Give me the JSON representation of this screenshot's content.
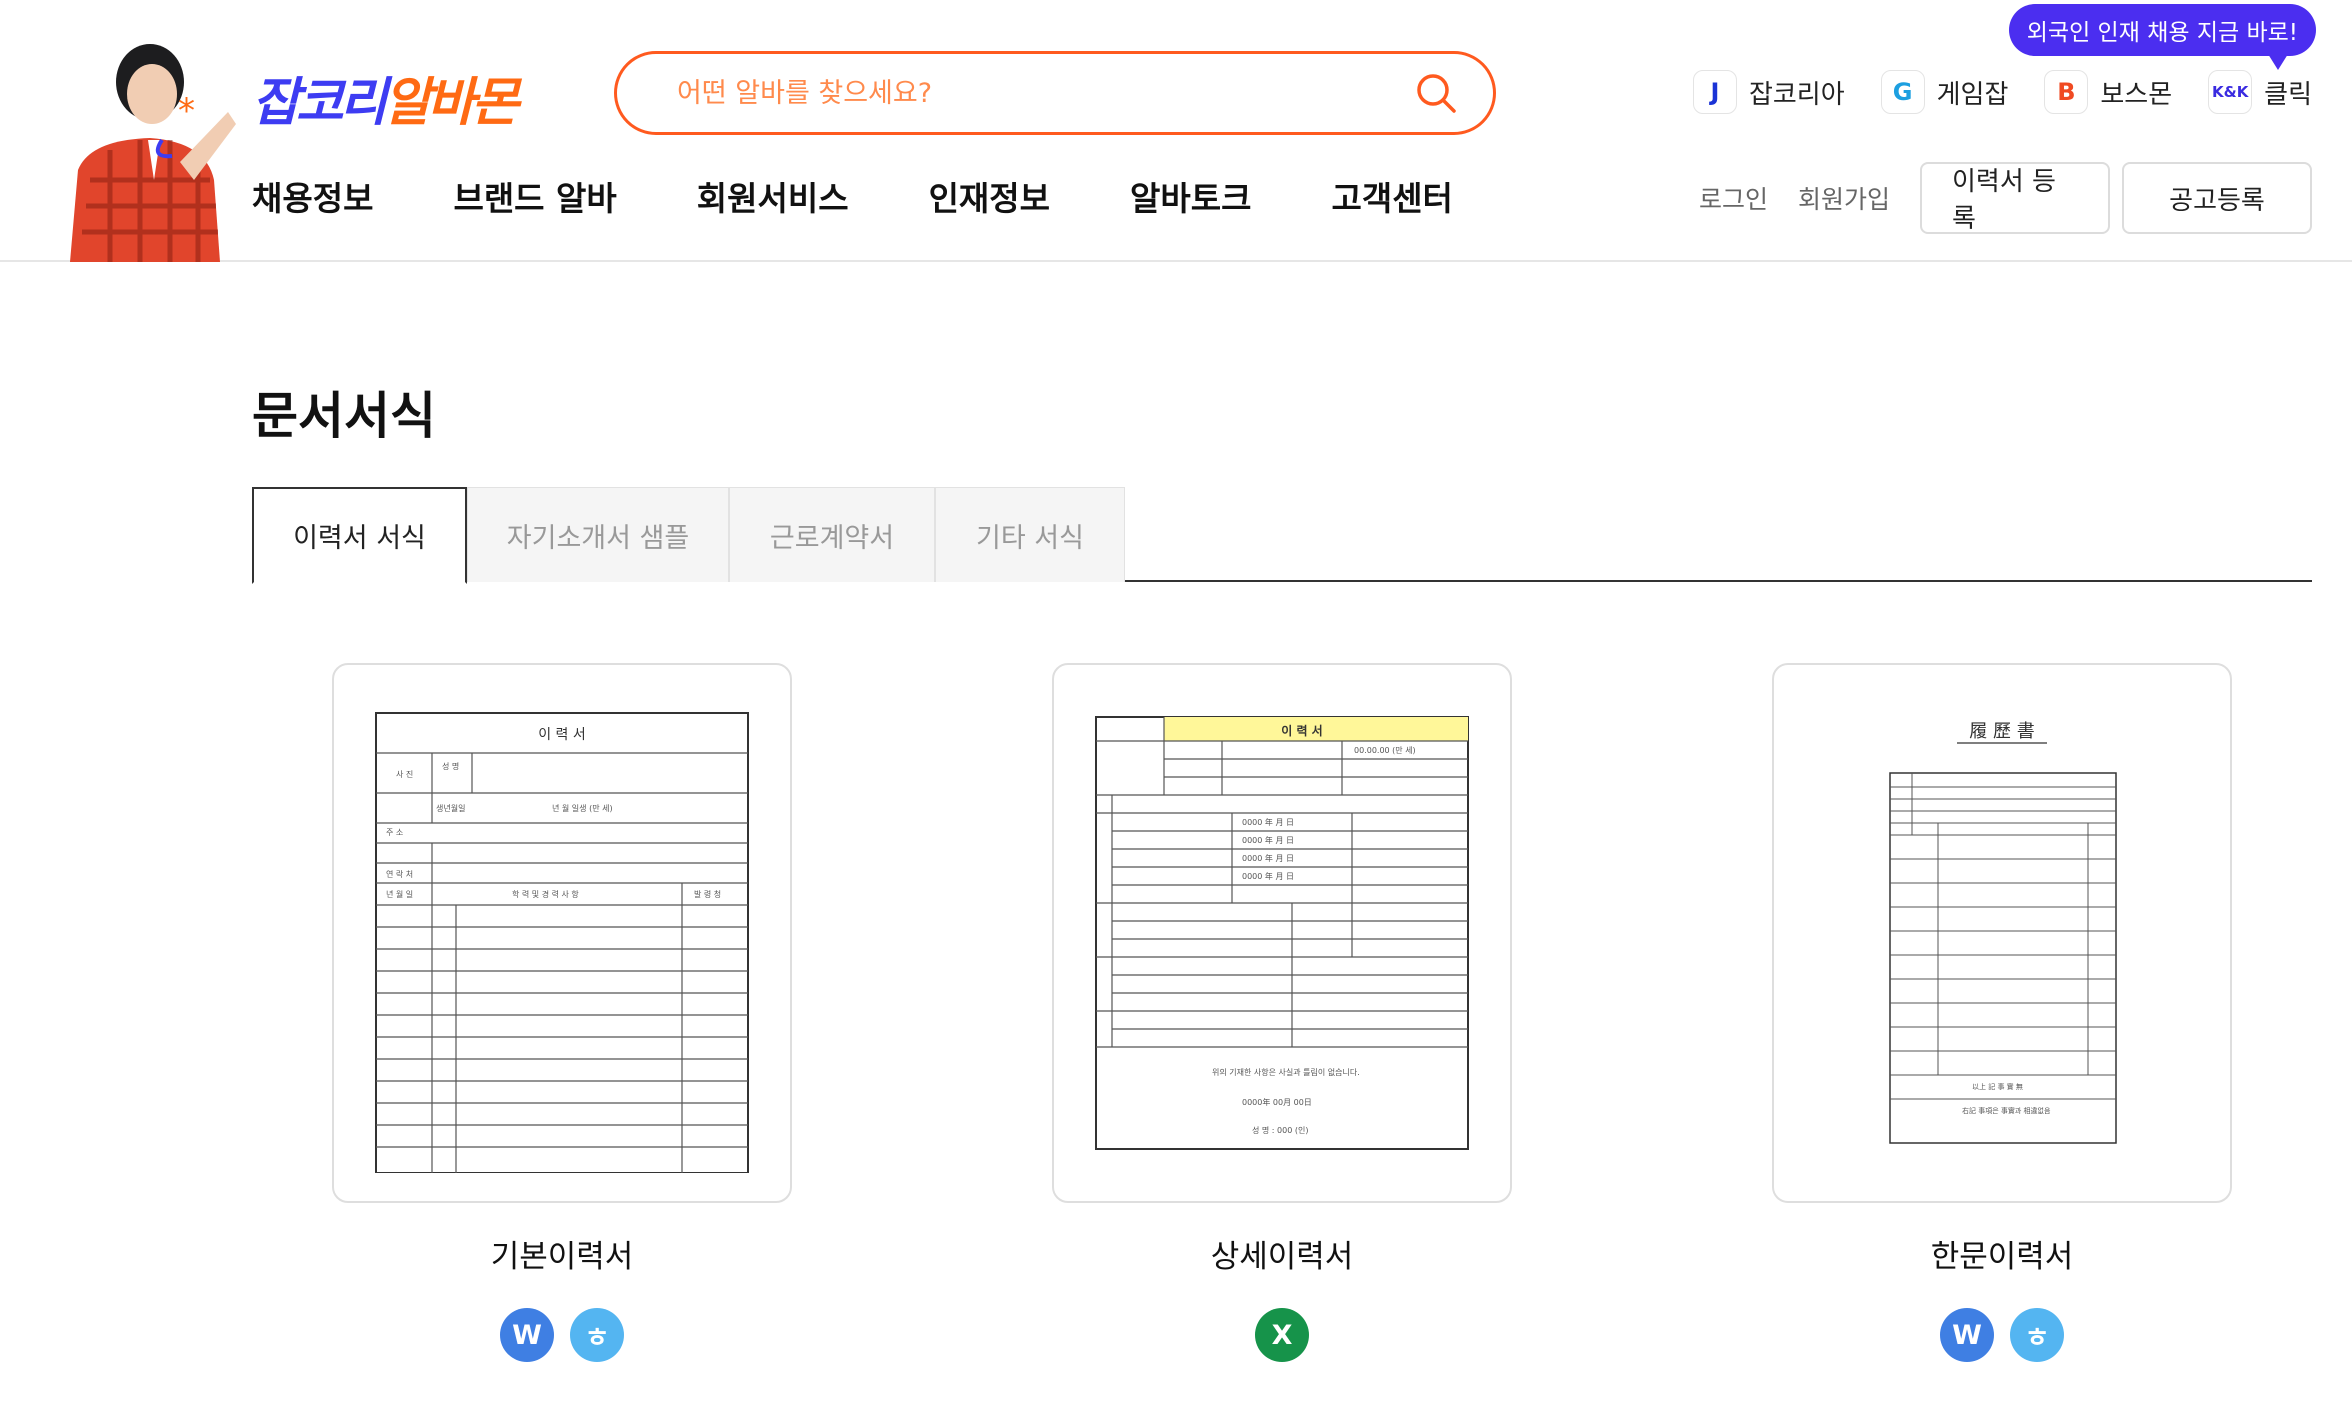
{
  "header": {
    "logo_part1": "잡코리",
    "logo_part2": "알바몬",
    "search_placeholder": "어떤 알바를 찾으세요?",
    "promo_bubble": "외국인 인재 채용 지금 바로!",
    "family_sites": [
      {
        "badge": "J",
        "label": "잡코리아",
        "color": "#1a33d6"
      },
      {
        "badge": "G",
        "label": "게임잡",
        "color": "#1c9fe0"
      },
      {
        "badge": "B",
        "label": "보스몬",
        "color": "#f04a22"
      },
      {
        "badge": "K&K",
        "label": "클릭",
        "color": "#3a2be0"
      }
    ],
    "nav": [
      "채용정보",
      "브랜드 알바",
      "회원서비스",
      "인재정보",
      "알바토크",
      "고객센터"
    ],
    "login": "로그인",
    "signup": "회원가입",
    "resume_button": "이력서 등록",
    "post_button": "공고등록"
  },
  "page": {
    "title": "문서서식",
    "tabs": [
      "이력서 서식",
      "자기소개서 샘플",
      "근로계약서",
      "기타 서식"
    ],
    "active_tab": 0
  },
  "documents": [
    {
      "name": "기본이력서",
      "preview_title": "이 력 서",
      "formats": [
        "W",
        "ㅎ"
      ]
    },
    {
      "name": "상세이력서",
      "preview_title": "이 력 서",
      "formats": [
        "X"
      ]
    },
    {
      "name": "한문이력서",
      "preview_title": "履 歷 書",
      "formats": [
        "W",
        "ㅎ"
      ]
    }
  ],
  "colors": {
    "brand_blue": "#3d3cf2",
    "brand_orange": "#ff6a13",
    "search_border": "#ff5a1f",
    "promo_purple": "#4b2ef0",
    "word_blue": "#3f7fe3",
    "hangul_blue": "#54b5f1",
    "excel_green": "#16934a"
  }
}
